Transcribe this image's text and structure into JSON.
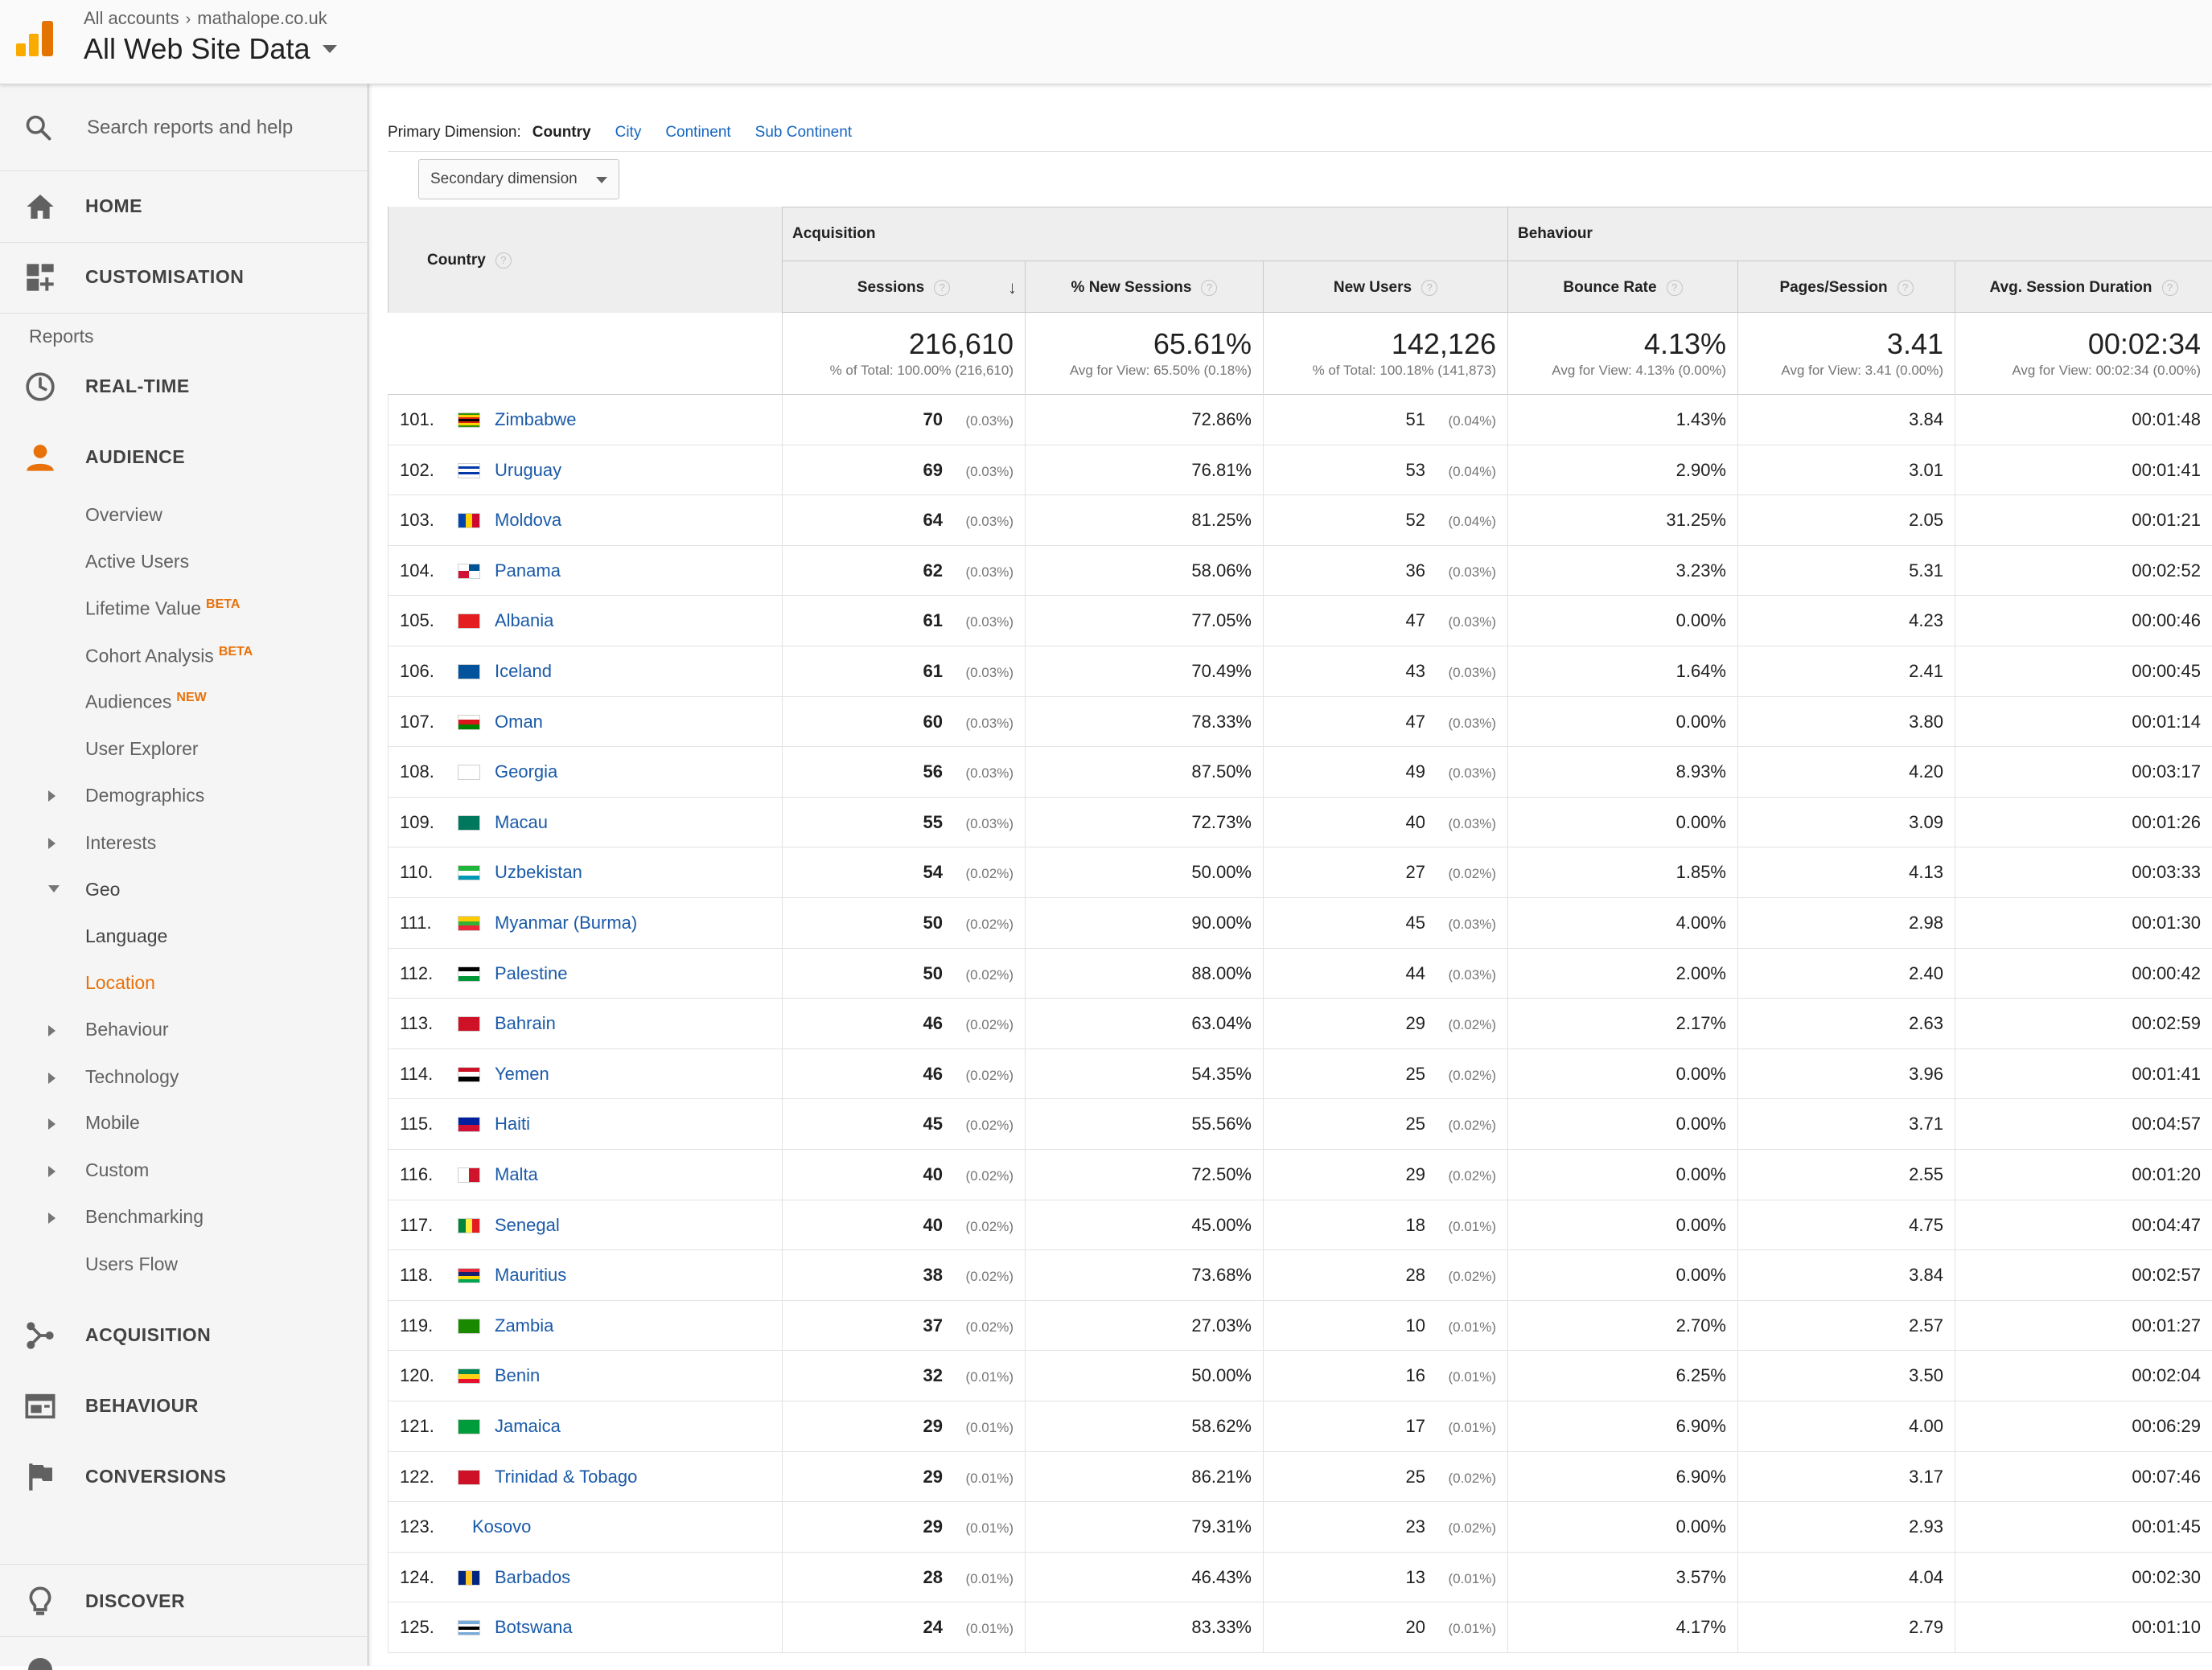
{
  "header": {
    "breadcrumb_1": "All accounts",
    "breadcrumb_2": "mathalope.co.uk",
    "title": "All Web Site Data"
  },
  "sidebar": {
    "search_label": "Search reports and help",
    "home": "HOME",
    "customisation": "CUSTOMISATION",
    "reports_label": "Reports",
    "realtime": "REAL-TIME",
    "audience": "AUDIENCE",
    "audience_items": {
      "overview": "Overview",
      "active_users": "Active Users",
      "lifetime_value": "Lifetime Value",
      "lifetime_badge": "BETA",
      "cohort_analysis": "Cohort Analysis",
      "cohort_badge": "BETA",
      "audiences": "Audiences",
      "audiences_badge": "NEW",
      "user_explorer": "User Explorer",
      "demographics": "Demographics",
      "interests": "Interests",
      "geo": "Geo",
      "language": "Language",
      "location": "Location",
      "behaviour": "Behaviour",
      "technology": "Technology",
      "mobile": "Mobile",
      "custom": "Custom",
      "benchmarking": "Benchmarking",
      "users_flow": "Users Flow"
    },
    "acquisition": "ACQUISITION",
    "behaviour": "BEHAVIOUR",
    "conversions": "CONVERSIONS",
    "discover": "DISCOVER"
  },
  "dimensions": {
    "label": "Primary Dimension:",
    "current": "Country",
    "city": "City",
    "continent": "Continent",
    "sub_continent": "Sub Continent",
    "secondary": "Secondary dimension"
  },
  "table": {
    "group_acquisition": "Acquisition",
    "group_behaviour": "Behaviour",
    "col_country": "Country",
    "col_sessions": "Sessions",
    "col_new_sessions": "% New Sessions",
    "col_new_users": "New Users",
    "col_bounce": "Bounce Rate",
    "col_pages": "Pages/Session",
    "col_duration": "Avg. Session Duration",
    "totals": {
      "sessions": "216,610",
      "sessions_sub": "% of Total: 100.00% (216,610)",
      "new_sessions": "65.61%",
      "new_sessions_sub": "Avg for View: 65.50% (0.18%)",
      "new_users": "142,126",
      "new_users_sub": "% of Total: 100.18% (141,873)",
      "bounce": "4.13%",
      "bounce_sub": "Avg for View: 4.13% (0.00%)",
      "pages": "3.41",
      "pages_sub": "Avg for View: 3.41 (0.00%)",
      "duration": "00:02:34",
      "duration_sub": "Avg for View: 00:02:34 (0.00%)"
    },
    "rows": [
      {
        "idx": "101.",
        "country": "Zimbabwe",
        "flag": "zw",
        "sessions": "70",
        "sessions_pct": "(0.03%)",
        "new_sessions": "72.86%",
        "new_users": "51",
        "new_users_pct": "(0.04%)",
        "bounce": "1.43%",
        "pages": "3.84",
        "duration": "00:01:48"
      },
      {
        "idx": "102.",
        "country": "Uruguay",
        "flag": "uy",
        "sessions": "69",
        "sessions_pct": "(0.03%)",
        "new_sessions": "76.81%",
        "new_users": "53",
        "new_users_pct": "(0.04%)",
        "bounce": "2.90%",
        "pages": "3.01",
        "duration": "00:01:41"
      },
      {
        "idx": "103.",
        "country": "Moldova",
        "flag": "md",
        "sessions": "64",
        "sessions_pct": "(0.03%)",
        "new_sessions": "81.25%",
        "new_users": "52",
        "new_users_pct": "(0.04%)",
        "bounce": "31.25%",
        "pages": "2.05",
        "duration": "00:01:21"
      },
      {
        "idx": "104.",
        "country": "Panama",
        "flag": "pa",
        "sessions": "62",
        "sessions_pct": "(0.03%)",
        "new_sessions": "58.06%",
        "new_users": "36",
        "new_users_pct": "(0.03%)",
        "bounce": "3.23%",
        "pages": "5.31",
        "duration": "00:02:52"
      },
      {
        "idx": "105.",
        "country": "Albania",
        "flag": "al",
        "sessions": "61",
        "sessions_pct": "(0.03%)",
        "new_sessions": "77.05%",
        "new_users": "47",
        "new_users_pct": "(0.03%)",
        "bounce": "0.00%",
        "pages": "4.23",
        "duration": "00:00:46"
      },
      {
        "idx": "106.",
        "country": "Iceland",
        "flag": "is",
        "sessions": "61",
        "sessions_pct": "(0.03%)",
        "new_sessions": "70.49%",
        "new_users": "43",
        "new_users_pct": "(0.03%)",
        "bounce": "1.64%",
        "pages": "2.41",
        "duration": "00:00:45"
      },
      {
        "idx": "107.",
        "country": "Oman",
        "flag": "om",
        "sessions": "60",
        "sessions_pct": "(0.03%)",
        "new_sessions": "78.33%",
        "new_users": "47",
        "new_users_pct": "(0.03%)",
        "bounce": "0.00%",
        "pages": "3.80",
        "duration": "00:01:14"
      },
      {
        "idx": "108.",
        "country": "Georgia",
        "flag": "ge",
        "sessions": "56",
        "sessions_pct": "(0.03%)",
        "new_sessions": "87.50%",
        "new_users": "49",
        "new_users_pct": "(0.03%)",
        "bounce": "8.93%",
        "pages": "4.20",
        "duration": "00:03:17"
      },
      {
        "idx": "109.",
        "country": "Macau",
        "flag": "mo",
        "sessions": "55",
        "sessions_pct": "(0.03%)",
        "new_sessions": "72.73%",
        "new_users": "40",
        "new_users_pct": "(0.03%)",
        "bounce": "0.00%",
        "pages": "3.09",
        "duration": "00:01:26"
      },
      {
        "idx": "110.",
        "country": "Uzbekistan",
        "flag": "uz",
        "sessions": "54",
        "sessions_pct": "(0.02%)",
        "new_sessions": "50.00%",
        "new_users": "27",
        "new_users_pct": "(0.02%)",
        "bounce": "1.85%",
        "pages": "4.13",
        "duration": "00:03:33"
      },
      {
        "idx": "111.",
        "country": "Myanmar (Burma)",
        "flag": "mm",
        "sessions": "50",
        "sessions_pct": "(0.02%)",
        "new_sessions": "90.00%",
        "new_users": "45",
        "new_users_pct": "(0.03%)",
        "bounce": "4.00%",
        "pages": "2.98",
        "duration": "00:01:30"
      },
      {
        "idx": "112.",
        "country": "Palestine",
        "flag": "ps",
        "sessions": "50",
        "sessions_pct": "(0.02%)",
        "new_sessions": "88.00%",
        "new_users": "44",
        "new_users_pct": "(0.03%)",
        "bounce": "2.00%",
        "pages": "2.40",
        "duration": "00:00:42"
      },
      {
        "idx": "113.",
        "country": "Bahrain",
        "flag": "bh",
        "sessions": "46",
        "sessions_pct": "(0.02%)",
        "new_sessions": "63.04%",
        "new_users": "29",
        "new_users_pct": "(0.02%)",
        "bounce": "2.17%",
        "pages": "2.63",
        "duration": "00:02:59"
      },
      {
        "idx": "114.",
        "country": "Yemen",
        "flag": "ye",
        "sessions": "46",
        "sessions_pct": "(0.02%)",
        "new_sessions": "54.35%",
        "new_users": "25",
        "new_users_pct": "(0.02%)",
        "bounce": "0.00%",
        "pages": "3.96",
        "duration": "00:01:41"
      },
      {
        "idx": "115.",
        "country": "Haiti",
        "flag": "ht",
        "sessions": "45",
        "sessions_pct": "(0.02%)",
        "new_sessions": "55.56%",
        "new_users": "25",
        "new_users_pct": "(0.02%)",
        "bounce": "0.00%",
        "pages": "3.71",
        "duration": "00:04:57"
      },
      {
        "idx": "116.",
        "country": "Malta",
        "flag": "mt",
        "sessions": "40",
        "sessions_pct": "(0.02%)",
        "new_sessions": "72.50%",
        "new_users": "29",
        "new_users_pct": "(0.02%)",
        "bounce": "0.00%",
        "pages": "2.55",
        "duration": "00:01:20"
      },
      {
        "idx": "117.",
        "country": "Senegal",
        "flag": "sn",
        "sessions": "40",
        "sessions_pct": "(0.02%)",
        "new_sessions": "45.00%",
        "new_users": "18",
        "new_users_pct": "(0.01%)",
        "bounce": "0.00%",
        "pages": "4.75",
        "duration": "00:04:47"
      },
      {
        "idx": "118.",
        "country": "Mauritius",
        "flag": "mu",
        "sessions": "38",
        "sessions_pct": "(0.02%)",
        "new_sessions": "73.68%",
        "new_users": "28",
        "new_users_pct": "(0.02%)",
        "bounce": "0.00%",
        "pages": "3.84",
        "duration": "00:02:57"
      },
      {
        "idx": "119.",
        "country": "Zambia",
        "flag": "zm",
        "sessions": "37",
        "sessions_pct": "(0.02%)",
        "new_sessions": "27.03%",
        "new_users": "10",
        "new_users_pct": "(0.01%)",
        "bounce": "2.70%",
        "pages": "2.57",
        "duration": "00:01:27"
      },
      {
        "idx": "120.",
        "country": "Benin",
        "flag": "bj",
        "sessions": "32",
        "sessions_pct": "(0.01%)",
        "new_sessions": "50.00%",
        "new_users": "16",
        "new_users_pct": "(0.01%)",
        "bounce": "6.25%",
        "pages": "3.50",
        "duration": "00:02:04"
      },
      {
        "idx": "121.",
        "country": "Jamaica",
        "flag": "jm",
        "sessions": "29",
        "sessions_pct": "(0.01%)",
        "new_sessions": "58.62%",
        "new_users": "17",
        "new_users_pct": "(0.01%)",
        "bounce": "6.90%",
        "pages": "4.00",
        "duration": "00:06:29"
      },
      {
        "idx": "122.",
        "country": "Trinidad & Tobago",
        "flag": "tt",
        "sessions": "29",
        "sessions_pct": "(0.01%)",
        "new_sessions": "86.21%",
        "new_users": "25",
        "new_users_pct": "(0.02%)",
        "bounce": "6.90%",
        "pages": "3.17",
        "duration": "00:07:46"
      },
      {
        "idx": "123.",
        "country": "Kosovo",
        "flag": "",
        "sessions": "29",
        "sessions_pct": "(0.01%)",
        "new_sessions": "79.31%",
        "new_users": "23",
        "new_users_pct": "(0.02%)",
        "bounce": "0.00%",
        "pages": "2.93",
        "duration": "00:01:45"
      },
      {
        "idx": "124.",
        "country": "Barbados",
        "flag": "bb",
        "sessions": "28",
        "sessions_pct": "(0.01%)",
        "new_sessions": "46.43%",
        "new_users": "13",
        "new_users_pct": "(0.01%)",
        "bounce": "3.57%",
        "pages": "4.04",
        "duration": "00:02:30"
      },
      {
        "idx": "125.",
        "country": "Botswana",
        "flag": "bw",
        "sessions": "24",
        "sessions_pct": "(0.01%)",
        "new_sessions": "83.33%",
        "new_users": "20",
        "new_users_pct": "(0.01%)",
        "bounce": "4.17%",
        "pages": "2.79",
        "duration": "00:01:10"
      }
    ]
  },
  "colors": {
    "accent_orange": "#e8710a",
    "link_blue": "#1a5aa8",
    "logo_orange": "#f9ab00",
    "logo_dark_orange": "#e37400"
  },
  "flag_stripes": {
    "zw": [
      "#319208",
      "#ffd200",
      "#de2010",
      "#000000",
      "#de2010",
      "#ffd200",
      "#319208"
    ],
    "uy": [
      "#ffffff",
      "#0038a8",
      "#ffffff",
      "#0038a8",
      "#ffffff"
    ],
    "md": [
      "v",
      "#0046ae",
      "#ffd200",
      "#cc092f"
    ],
    "pa": [
      "q",
      "#ffffff",
      "#d21034",
      "#005293",
      "#ffffff"
    ],
    "al": [
      "#e41e20"
    ],
    "is": [
      "#02529c"
    ],
    "om": [
      "#ffffff",
      "#db161b",
      "#008000"
    ],
    "ge": [
      "#ffffff"
    ],
    "mo": [
      "#00785e"
    ],
    "uz": [
      "#1eb53a",
      "#ffffff",
      "#0099b5"
    ],
    "mm": [
      "#fecb00",
      "#34b233",
      "#ea2839"
    ],
    "ps": [
      "#000000",
      "#ffffff",
      "#009736"
    ],
    "bh": [
      "#ce1126"
    ],
    "ye": [
      "#ce1126",
      "#ffffff",
      "#000000"
    ],
    "ht": [
      "#00209f",
      "#d21034"
    ],
    "mt": [
      "v",
      "#ffffff",
      "#cf142b"
    ],
    "sn": [
      "v",
      "#00853f",
      "#fdef42",
      "#e31b23"
    ],
    "mu": [
      "#ea2839",
      "#1a206d",
      "#ffd500",
      "#00a551"
    ],
    "zm": [
      "#198a00"
    ],
    "bj": [
      "#008751",
      "#fcd116",
      "#e8112d"
    ],
    "jm": [
      "#009b3a"
    ],
    "tt": [
      "#ce1126"
    ],
    "bb": [
      "v",
      "#00267f",
      "#ffc726",
      "#00267f"
    ],
    "bw": [
      "#75aadb",
      "#ffffff",
      "#000000",
      "#ffffff",
      "#75aadb"
    ]
  }
}
